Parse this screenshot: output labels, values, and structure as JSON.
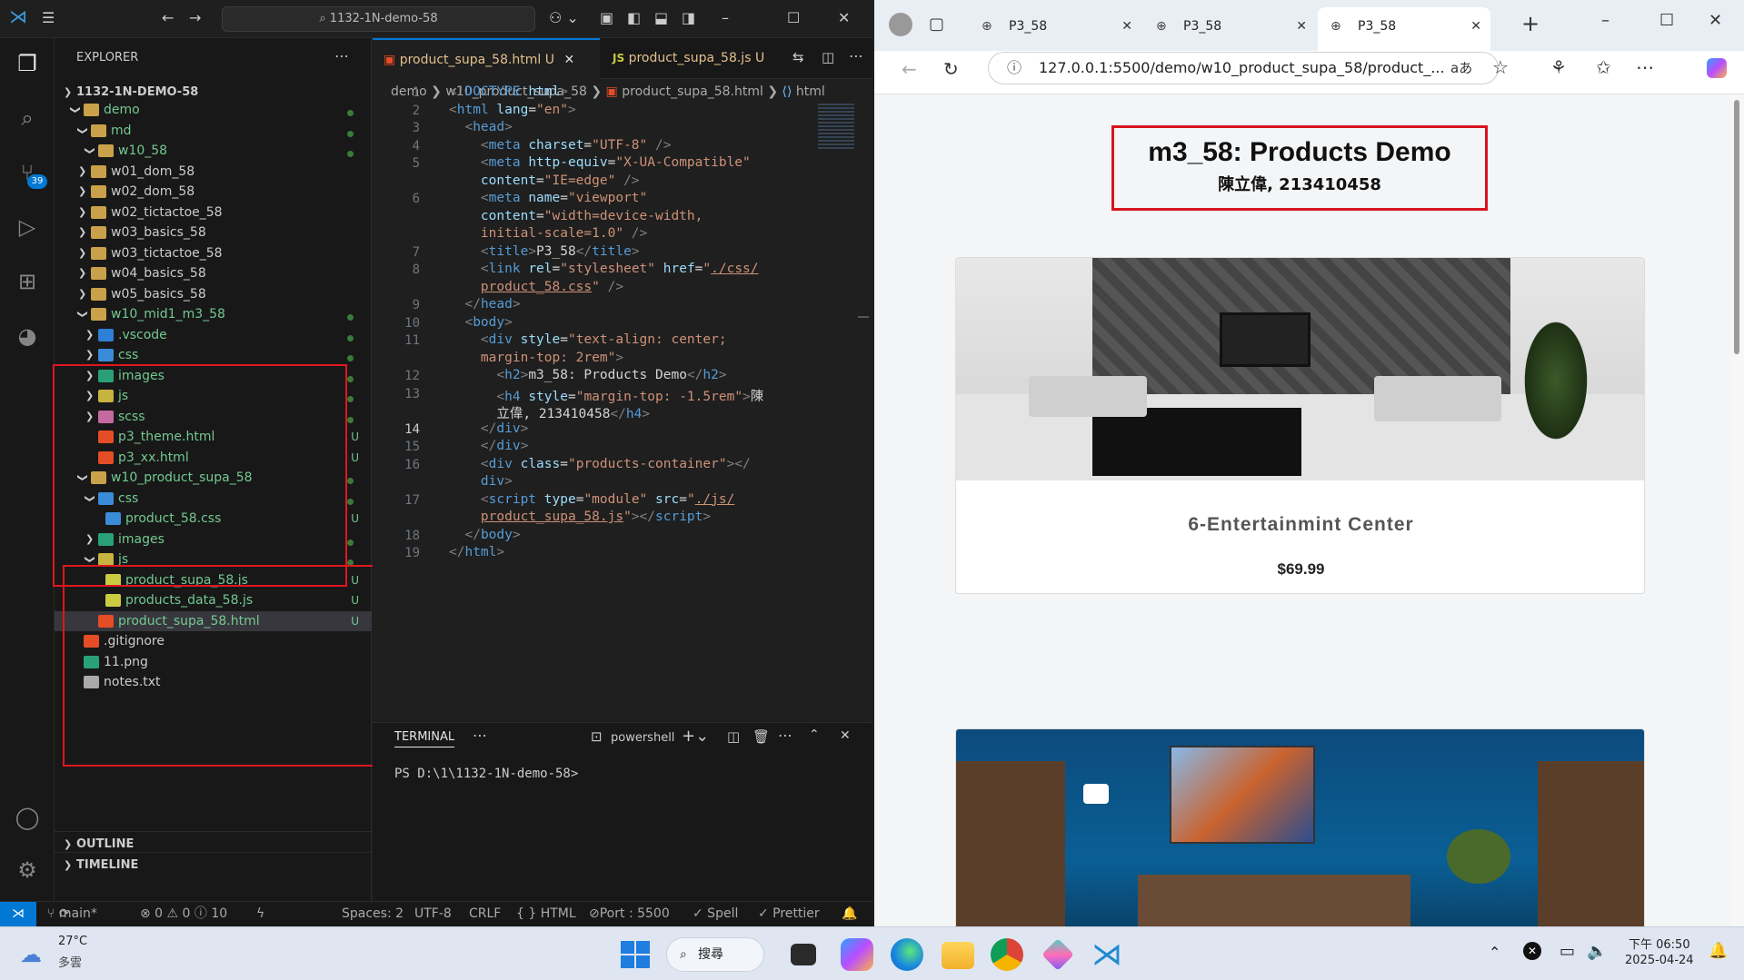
{
  "vscode": {
    "command_center": "1132-1N-demo-58",
    "source_control_badge": "39",
    "explorer": {
      "title": "EXPLORER",
      "root": "1132-1N-DEMO-58",
      "items": [
        {
          "label": "demo",
          "indent": 1,
          "type": "folder",
          "open": true,
          "status": ""
        },
        {
          "label": "md",
          "indent": 2,
          "type": "folder",
          "open": true,
          "status": ""
        },
        {
          "label": "w10_58",
          "indent": 3,
          "type": "folder",
          "open": true,
          "status": ""
        },
        {
          "label": "w01_dom_58",
          "indent": 2,
          "type": "folder",
          "open": false,
          "status": ""
        },
        {
          "label": "w02_dom_58",
          "indent": 2,
          "type": "folder",
          "open": false,
          "status": ""
        },
        {
          "label": "w02_tictactoe_58",
          "indent": 2,
          "type": "folder",
          "open": false,
          "status": ""
        },
        {
          "label": "w03_basics_58",
          "indent": 2,
          "type": "folder",
          "open": false,
          "status": ""
        },
        {
          "label": "w03_tictactoe_58",
          "indent": 2,
          "type": "folder",
          "open": false,
          "status": ""
        },
        {
          "label": "w04_basics_58",
          "indent": 2,
          "type": "folder",
          "open": false,
          "status": ""
        },
        {
          "label": "w05_basics_58",
          "indent": 2,
          "type": "folder",
          "open": false,
          "status": ""
        },
        {
          "label": "w10_mid1_m3_58",
          "indent": 2,
          "type": "folder",
          "open": true,
          "status": ""
        },
        {
          "label": ".vscode",
          "indent": 3,
          "type": "folder-vscode",
          "open": false,
          "status": ""
        },
        {
          "label": "css",
          "indent": 3,
          "type": "folder-css",
          "open": false,
          "status": ""
        },
        {
          "label": "images",
          "indent": 3,
          "type": "folder-images",
          "open": false,
          "status": ""
        },
        {
          "label": "js",
          "indent": 3,
          "type": "folder-js",
          "open": false,
          "status": ""
        },
        {
          "label": "scss",
          "indent": 3,
          "type": "folder-scss",
          "open": false,
          "status": ""
        },
        {
          "label": "p3_theme.html",
          "indent": 3,
          "type": "html",
          "open": false,
          "status": "U"
        },
        {
          "label": "p3_xx.html",
          "indent": 3,
          "type": "html",
          "open": false,
          "status": "U"
        },
        {
          "label": "w10_product_supa_58",
          "indent": 2,
          "type": "folder",
          "open": true,
          "status": ""
        },
        {
          "label": "css",
          "indent": 3,
          "type": "folder-css",
          "open": true,
          "status": ""
        },
        {
          "label": "product_58.css",
          "indent": 4,
          "type": "css",
          "open": false,
          "status": "U"
        },
        {
          "label": "images",
          "indent": 3,
          "type": "folder-images",
          "open": false,
          "status": ""
        },
        {
          "label": "js",
          "indent": 3,
          "type": "folder-js",
          "open": true,
          "status": ""
        },
        {
          "label": "product_supa_58.js",
          "indent": 4,
          "type": "js",
          "open": false,
          "status": "U"
        },
        {
          "label": "products_data_58.js",
          "indent": 4,
          "type": "js",
          "open": false,
          "status": "U"
        },
        {
          "label": "product_supa_58.html",
          "indent": 3,
          "type": "html",
          "open": false,
          "status": "U"
        },
        {
          "label": ".gitignore",
          "indent": 1,
          "type": "git",
          "open": false,
          "status": ""
        },
        {
          "label": "11.png",
          "indent": 1,
          "type": "png",
          "open": false,
          "status": ""
        },
        {
          "label": "notes.txt",
          "indent": 1,
          "type": "txt",
          "open": false,
          "status": ""
        }
      ],
      "outline": "OUTLINE",
      "timeline": "TIMELINE"
    },
    "tabs": [
      {
        "label": "product_supa_58.html",
        "mark": "U",
        "active": true
      },
      {
        "label": "product_supa_58.js",
        "mark": "U",
        "active": false
      }
    ],
    "breadcrumb": [
      "demo",
      "w10_product_supa_58",
      "product_supa_58.html",
      "html"
    ],
    "code_lines": [
      {
        "n": "1",
        "html": "<span class='t'>&lt;!</span><span class='tn'>DOCTYPE</span> <span class='an'>html</span><span class='t'>&gt;</span>"
      },
      {
        "n": "2",
        "html": "<span class='t'>&lt;</span><span class='tn'>html</span> <span class='an'>lang</span><span class='tx'>=</span><span class='av'>\"en\"</span><span class='t'>&gt;</span>"
      },
      {
        "n": "3",
        "html": "  <span class='t'>&lt;</span><span class='tn'>head</span><span class='t'>&gt;</span>"
      },
      {
        "n": "4",
        "html": "    <span class='t'>&lt;</span><span class='tn'>meta</span> <span class='an'>charset</span><span class='tx'>=</span><span class='av'>\"UTF-8\"</span> <span class='t'>/&gt;</span>"
      },
      {
        "n": "5",
        "html": "    <span class='t'>&lt;</span><span class='tn'>meta</span> <span class='an'>http-equiv</span><span class='tx'>=</span><span class='av'>\"X-UA-Compatible\"</span>"
      },
      {
        "n": "",
        "html": "    <span class='an'>content</span><span class='tx'>=</span><span class='av'>\"IE=edge\"</span> <span class='t'>/&gt;</span>"
      },
      {
        "n": "6",
        "html": "    <span class='t'>&lt;</span><span class='tn'>meta</span> <span class='an'>name</span><span class='tx'>=</span><span class='av'>\"viewport\"</span>"
      },
      {
        "n": "",
        "html": "    <span class='an'>content</span><span class='tx'>=</span><span class='av'>\"width=device-width,</span>"
      },
      {
        "n": "",
        "html": "    <span class='av'>initial-scale=1.0\"</span> <span class='t'>/&gt;</span>"
      },
      {
        "n": "7",
        "html": "    <span class='t'>&lt;</span><span class='tn'>title</span><span class='t'>&gt;</span><span class='tx'>P3_58</span><span class='t'>&lt;/</span><span class='tn'>title</span><span class='t'>&gt;</span>"
      },
      {
        "n": "8",
        "html": "    <span class='t'>&lt;</span><span class='tn'>link</span> <span class='an'>rel</span><span class='tx'>=</span><span class='av'>\"stylesheet\"</span> <span class='an'>href</span><span class='tx'>=</span><span class='av'>\"<u>./css/</u></span>"
      },
      {
        "n": "",
        "html": "    <span class='av'><u>product_58.css</u>\"</span> <span class='t'>/&gt;</span>"
      },
      {
        "n": "9",
        "html": "  <span class='t'>&lt;/</span><span class='tn'>head</span><span class='t'>&gt;</span>"
      },
      {
        "n": "10",
        "html": "  <span class='t'>&lt;</span><span class='tn'>body</span><span class='t'>&gt;</span>"
      },
      {
        "n": "11",
        "html": "    <span class='t'>&lt;</span><span class='tn'>div</span> <span class='an'>style</span><span class='tx'>=</span><span class='av'>\"text-align: center;</span>"
      },
      {
        "n": "",
        "html": "    <span class='av'>margin-top: 2rem\"</span><span class='t'>&gt;</span>"
      },
      {
        "n": "12",
        "html": "      <span class='t'>&lt;</span><span class='tn'>h2</span><span class='t'>&gt;</span><span class='tx'>m3_58: Products Demo</span><span class='t'>&lt;/</span><span class='tn'>h2</span><span class='t'>&gt;</span>"
      },
      {
        "n": "13",
        "html": "      <span class='t'>&lt;</span><span class='tn'>h4</span> <span class='an'>style</span><span class='tx'>=</span><span class='av'>\"margin-top: -1.5rem\"</span><span class='t'>&gt;</span><span class='tx'>陳</span>"
      },
      {
        "n": "",
        "html": "      <span class='tx'>立偉, 213410458</span><span class='t'>&lt;/</span><span class='tn'>h4</span><span class='t'>&gt;</span>"
      },
      {
        "n": "14",
        "html": "    <span class='t'>&lt;/</span><span class='tn'>div</span><span class='t'>&gt;</span>"
      },
      {
        "n": "15",
        "html": "    <span class='t'>&lt;/</span><span class='tn'>div</span><span class='t'>&gt;</span>"
      },
      {
        "n": "16",
        "html": "    <span class='t'>&lt;</span><span class='tn'>div</span> <span class='an'>class</span><span class='tx'>=</span><span class='av'>\"products-container\"</span><span class='t'>&gt;&lt;/</span>"
      },
      {
        "n": "",
        "html": "    <span class='tn'>div</span><span class='t'>&gt;</span>"
      },
      {
        "n": "17",
        "html": "    <span class='t'>&lt;</span><span class='tn'>script</span> <span class='an'>type</span><span class='tx'>=</span><span class='av'>\"module\"</span> <span class='an'>src</span><span class='tx'>=</span><span class='av'>\"<u>./js/</u></span>"
      },
      {
        "n": "",
        "html": "    <span class='av'><u>product_supa_58.js</u>\"</span><span class='t'>&gt;&lt;/</span><span class='tn'>script</span><span class='t'>&gt;</span>"
      },
      {
        "n": "18",
        "html": "  <span class='t'>&lt;/</span><span class='tn'>body</span><span class='t'>&gt;</span>"
      },
      {
        "n": "19",
        "html": "<span class='t'>&lt;/</span><span class='tn'>html</span><span class='t'>&gt;</span>"
      }
    ],
    "terminal": {
      "title": "TERMINAL",
      "shell": "powershell",
      "prompt": "PS D:\\1\\1132-1N-demo-58>"
    },
    "status": {
      "branch": "main*",
      "problems": "⊗ 0 ⚠ 0 ⓘ 10",
      "spaces": "Spaces: 2",
      "encoding": "UTF-8",
      "eol": "CRLF",
      "language": "{ } HTML",
      "port": "Port : 5500",
      "spell": "✓ Spell",
      "prettier": "✓ Prettier"
    }
  },
  "browser": {
    "tabs": [
      "P3_58",
      "P3_58",
      "P3_58"
    ],
    "url": "127.0.0.1:5500/demo/w10_product_supa_58/product_...",
    "page": {
      "title": "m3_58: Products Demo",
      "subtitle": "陳立偉, 213410458",
      "products": [
        {
          "name": "6-Entertainmint Center",
          "price": "$69.99"
        }
      ]
    }
  },
  "taskbar": {
    "weather_temp": "27°C",
    "weather_desc": "多雲",
    "search": "搜尋",
    "time": "下午 06:50",
    "date": "2025-04-24"
  }
}
